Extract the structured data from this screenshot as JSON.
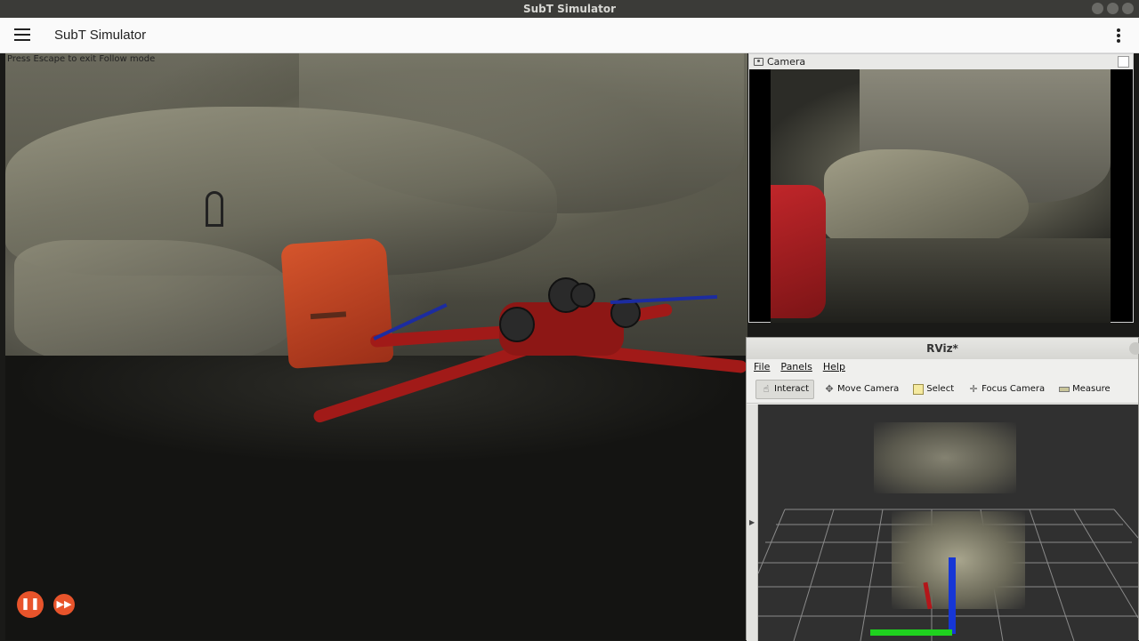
{
  "window": {
    "title": "SubT Simulator"
  },
  "app_bar": {
    "title": "SubT Simulator"
  },
  "scene": {
    "hint": "Press Escape to exit Follow mode"
  },
  "camera_panel": {
    "title": "Camera"
  },
  "rviz": {
    "title": "RViz*",
    "menu": [
      "File",
      "Panels",
      "Help"
    ],
    "tools": [
      {
        "label": "Interact",
        "icon": "hand-icon",
        "active": true
      },
      {
        "label": "Move Camera",
        "icon": "move-icon",
        "active": false
      },
      {
        "label": "Select",
        "icon": "select-icon",
        "active": false
      },
      {
        "label": "Focus Camera",
        "icon": "crosshair-icon",
        "active": false
      },
      {
        "label": "Measure",
        "icon": "ruler-icon",
        "active": false
      }
    ]
  },
  "controls": {
    "pause": "❚❚",
    "fast_forward": "▶▶"
  },
  "colors": {
    "accent": "#e8542b",
    "drone": "#a11a18",
    "axis_x": "#1fd11f",
    "axis_z": "#1636d6"
  }
}
